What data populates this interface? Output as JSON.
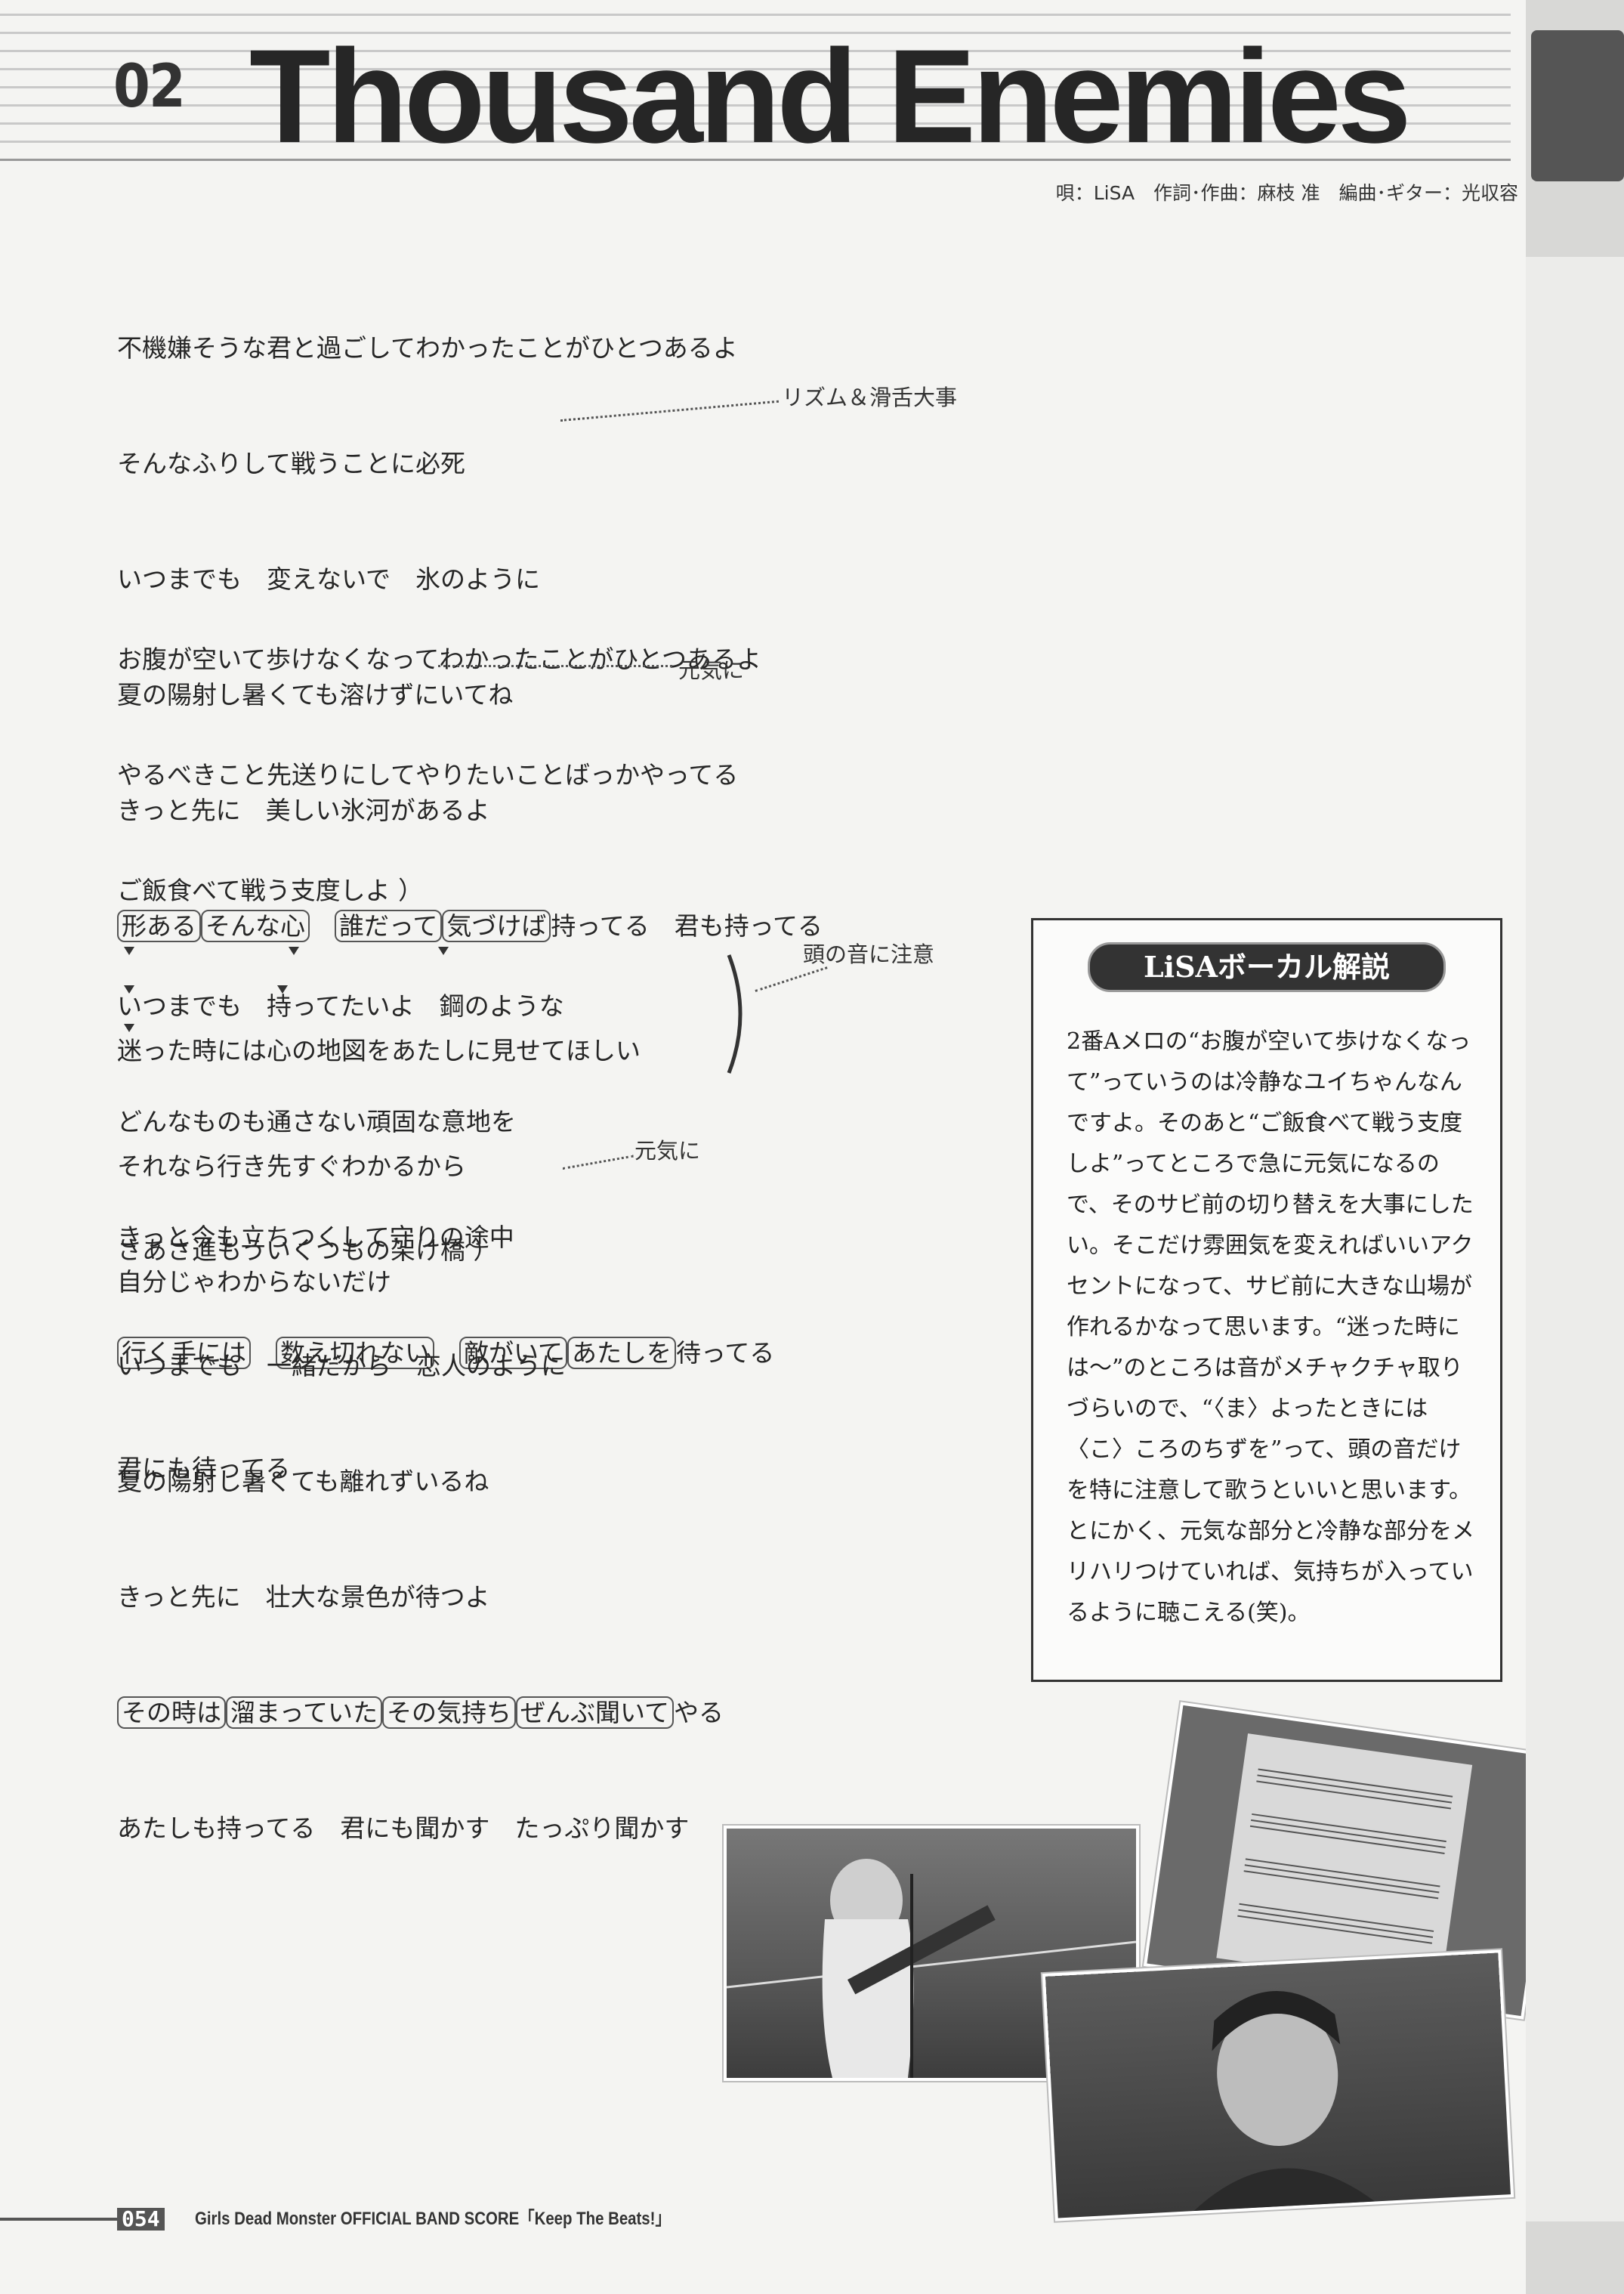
{
  "header": {
    "track_number": "02",
    "title": "Thousand Enemies",
    "credits": "唄：LiSA　作詞･作曲：麻枝 准　編曲･ギター：光収容"
  },
  "lyrics": {
    "stanza1": [
      "不機嫌そうな君と過ごしてわかったことがひとつあるよ",
      "そんなふりして戦うことに必死",
      "いつまでも　変えないで　氷のように",
      "夏の陽射し暑くても溶けずにいてね",
      "きっと先に　美しい氷河があるよ"
    ],
    "stanza1_last": {
      "b1": "形ある",
      "b2": "そんな心",
      "b3": "誰だって",
      "b4": "気づけば",
      "rest": "持ってる　君も持ってる"
    },
    "stanza2": [
      "お腹が空いて歩けなくなってわかったことがひとつあるよ",
      "やるべきこと先送りにしてやりたいことばっかやってる",
      "ご飯食べて戦う支度しよ ）",
      "いつまでも　持ってたいよ　鋼のような",
      "どんなものも通さない頑固な意地を",
      "きっと今も立ちつくして守りの途中"
    ],
    "stanza2_boxed": {
      "b1": "行く手には",
      "b2": "数え切れない",
      "b3": "敵がいて",
      "b4": "あたしを",
      "rest": "待ってる"
    },
    "stanza2_last": "君にも待ってる",
    "stanza3": [
      "迷った時には心の地図をあたしに見せてほしい",
      "それなら行き先すぐわかるから",
      "自分じゃわからないだけ"
    ],
    "stanza4": [
      "さあさ進もういくつもの架け橋 ）",
      "いつまでも　一緒だから　恋人のように",
      "夏の陽射し暑くても離れずいるね",
      "きっと先に　壮大な景色が待つよ"
    ],
    "stanza4_boxed": {
      "b1": "その時は",
      "b2": "溜まっていた",
      "b3": "その気持ち",
      "b4": "ぜんぶ聞いて",
      "rest": "やる"
    },
    "stanza4_last": "あたしも持ってる　君にも聞かす　たっぷり聞かす"
  },
  "notes": {
    "rhythm": "リズム＆滑舌大事",
    "genki1": "元気に",
    "attention": "頭の音に注意",
    "genki2": "元気に"
  },
  "commentary": {
    "title": "LiSAボーカル解説",
    "body": "2番Aメロの“お腹が空いて歩けなくなって”っていうのは冷静なユイちゃんなんですよ。そのあと“ご飯食べて戦う支度しよ”ってところで急に元気になるので、そのサビ前の切り替えを大事にしたい。そこだけ雰囲気を変えればいいアクセントになって、サビ前に大きな山場が作れるかなって思います。“迷った時には〜”のところは音がメチャクチャ取りづらいので、“〈ま〉よったときには〈こ〉ころのちずを”って、頭の音だけを特に注意して歌うといいと思います。とにかく、元気な部分と冷静な部分をメリハリつけていれば、気持ちが入っているように聴こえる(笑)。"
  },
  "footer": {
    "page_number": "054",
    "series": "Girls Dead Monster  OFFICIAL BAND SCORE「Keep The Beats!」"
  },
  "colors": {
    "ink": "#222222",
    "paper": "#f4f4f2",
    "box_title_bg": "#333333"
  }
}
